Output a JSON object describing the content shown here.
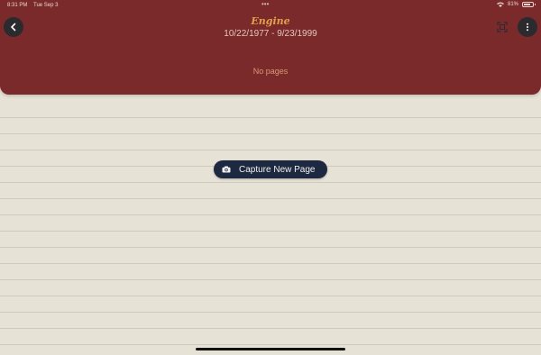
{
  "status_bar": {
    "time": "8:31 PM",
    "date": "Tue Sep 3",
    "dots": "•••",
    "battery_text": "81%",
    "battery_level": 0.81
  },
  "header": {
    "title": "Engine",
    "date_range": "10/22/1977 - 9/23/1999",
    "empty_text": "No pages",
    "colors": {
      "background": "#7b2a2b",
      "title": "#e3a04a"
    }
  },
  "icons": {
    "back": "chevron-left-icon",
    "scan": "scan-frame-icon",
    "more": "ellipsis-vertical-icon",
    "camera": "camera-icon"
  },
  "main": {
    "capture_label": "Capture New Page"
  }
}
